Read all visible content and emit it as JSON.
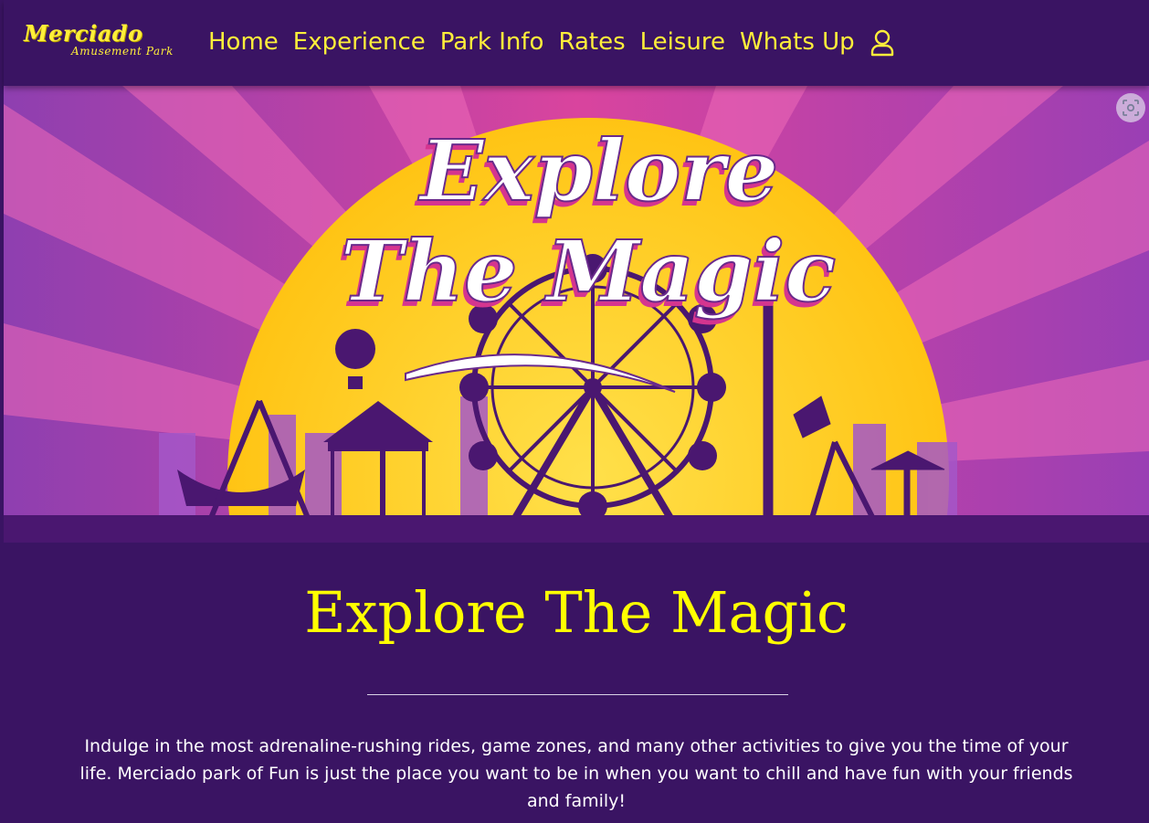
{
  "brand": {
    "name": "Merciado",
    "tagline": "Amusement Park"
  },
  "nav": {
    "items": [
      {
        "label": "Home"
      },
      {
        "label": "Experience"
      },
      {
        "label": "Park Info"
      },
      {
        "label": "Rates"
      },
      {
        "label": "Leisure"
      },
      {
        "label": "Whats Up"
      }
    ],
    "account_icon": "user-icon"
  },
  "hero": {
    "banner_text_line1": "Explore",
    "banner_text_line2": "The Magic",
    "visual_search_icon": "lens-icon"
  },
  "main": {
    "heading": "Explore The Magic",
    "description": "Indulge in the most adrenaline-rushing rides, game zones, and many other activities to give you the time of your life. Merciado park of Fun is just the place you want to be in when you want to chill and have fun with your friends and family!"
  },
  "colors": {
    "background": "#3a1463",
    "accent_yellow": "#ffef3a",
    "heading_yellow": "#ffff00",
    "sun": "#ffd21f",
    "hero_pink": "#e040a8",
    "silhouette": "#4a1770"
  }
}
